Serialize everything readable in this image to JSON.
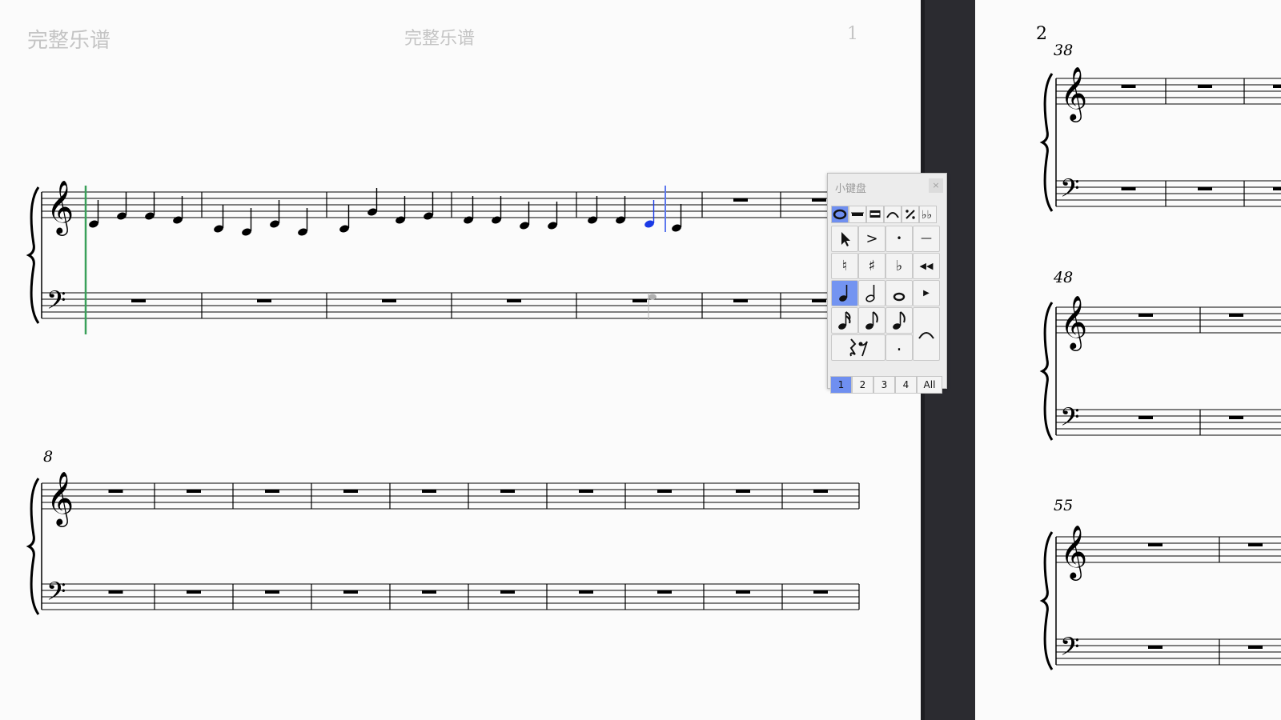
{
  "page1": {
    "header_left": "完整乐谱",
    "header_center": "完整乐谱",
    "page_number": "1"
  },
  "system2": {
    "measure_number": "8"
  },
  "page2": {
    "page_number": "2",
    "systems": [
      {
        "measure_number": "38"
      },
      {
        "measure_number": "48"
      },
      {
        "measure_number": "55"
      }
    ]
  },
  "palette": {
    "title": "小键盘",
    "close": "×",
    "tabs": [
      "whole-note-tab",
      "rest-tab",
      "beam-tab",
      "tie-tab",
      "repeat-tab",
      "double-flat-tab"
    ],
    "buttons": {
      "pointer": "pointer",
      "accent": ">",
      "staccato": "•",
      "tenuto": "—",
      "natural": "♮",
      "sharp": "♯",
      "flat": "♭",
      "rewind": "◀◀",
      "play": "▶",
      "dot": "."
    },
    "voices": [
      "1",
      "2",
      "3",
      "4",
      "All"
    ],
    "active_tab": 0,
    "active_duration": "quarter-note",
    "active_voice": "1"
  }
}
